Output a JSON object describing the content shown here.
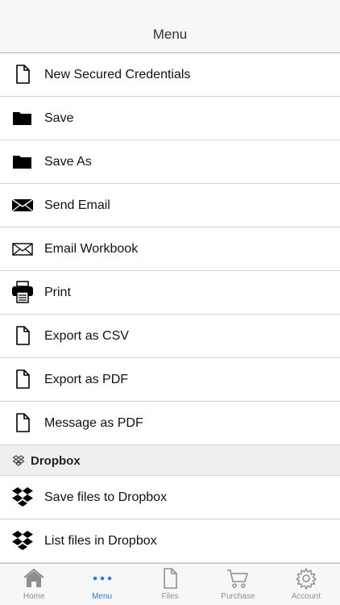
{
  "header": {
    "title": "Menu"
  },
  "menu": {
    "items": [
      {
        "label": "New Secured Credentials",
        "icon": "document-icon"
      },
      {
        "label": "Save",
        "icon": "folder-icon"
      },
      {
        "label": "Save As",
        "icon": "folder-icon"
      },
      {
        "label": "Send Email",
        "icon": "envelope-filled-icon"
      },
      {
        "label": "Email Workbook",
        "icon": "envelope-outline-icon"
      },
      {
        "label": "Print",
        "icon": "printer-icon"
      },
      {
        "label": "Export as CSV",
        "icon": "document-icon"
      },
      {
        "label": "Export as PDF",
        "icon": "document-icon"
      },
      {
        "label": "Message as PDF",
        "icon": "document-icon"
      }
    ]
  },
  "dropbox": {
    "section_title": "Dropbox",
    "section_icon": "dropbox-icon",
    "items": [
      {
        "label": "Save files to Dropbox",
        "icon": "dropbox-icon"
      },
      {
        "label": "List files in Dropbox",
        "icon": "dropbox-icon"
      }
    ]
  },
  "tabbar": {
    "active": "Menu",
    "active_color": "#2a7ee0",
    "tabs": [
      {
        "label": "Home",
        "icon": "home-icon"
      },
      {
        "label": "Menu",
        "icon": "more-dots-icon"
      },
      {
        "label": "Files",
        "icon": "file-icon"
      },
      {
        "label": "Purchase",
        "icon": "cart-icon"
      },
      {
        "label": "Account",
        "icon": "gear-icon"
      }
    ]
  }
}
